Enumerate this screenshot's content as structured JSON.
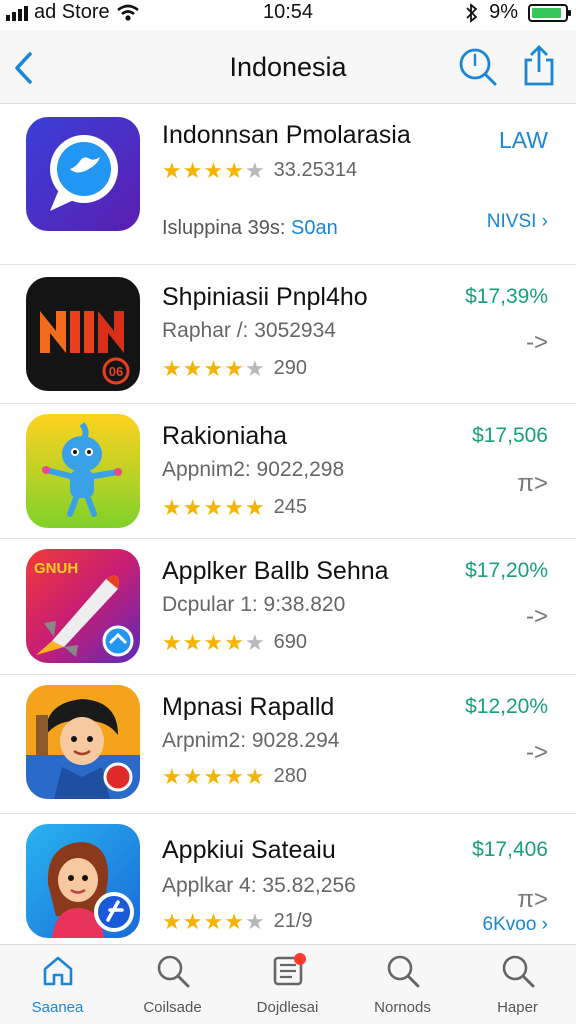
{
  "status_bar": {
    "carrier": "ad Store",
    "time": "10:54",
    "battery": "9%",
    "battery_level": 0.9
  },
  "nav": {
    "title": "Indonesia",
    "icons": [
      "back-chevron-icon",
      "search-icon",
      "share-icon"
    ]
  },
  "apps": [
    {
      "name": "Indonnsan Pmolarasia",
      "rating_text": "33.25314",
      "rating": 3.5,
      "detail_prefix": "Isluppina 39s:",
      "detail_highlight": "S0an",
      "action": "LAW",
      "more": "NIVSI ›"
    },
    {
      "name": "Shpiniasii Pnpl4ho",
      "subtitle": "Raphar /: 3052934",
      "rating": 4,
      "rating_count": "290",
      "price": "$17,39%",
      "arrow": "->"
    },
    {
      "name": "Rakioniaha",
      "subtitle": "Appnim2: 9022,298",
      "rating": 4.5,
      "rating_count": "245",
      "price": "$17,506",
      "arrow": "π>"
    },
    {
      "name": "Applker Ballb Sehna",
      "subtitle": "Dcpular 1: 9:38.820",
      "rating": 4,
      "rating_count": "690",
      "price": "$17,20%",
      "arrow": "->"
    },
    {
      "name": "Mpnasi Rapalld",
      "subtitle": "Arpnim2: 9028.294",
      "rating": 4.5,
      "rating_count": "280",
      "price": "$12,20%",
      "arrow": "->"
    },
    {
      "name": "Appkiui Sateaiu",
      "subtitle": "Applkar 4: 35.82,256",
      "rating": 4,
      "rating_count": "21/9",
      "price": "$17,406",
      "arrow": "π>",
      "more": "6Kvoo ›"
    }
  ],
  "tabs": [
    {
      "label": "Saanea",
      "icon": "home-icon",
      "active": true
    },
    {
      "label": "Coilsade",
      "icon": "search-icon"
    },
    {
      "label": "Dojdlesai",
      "icon": "updates-icon"
    },
    {
      "label": "Nornods",
      "icon": "search-icon"
    },
    {
      "label": "Haper",
      "icon": "search-icon"
    }
  ],
  "colors": {
    "accent": "#1a86d6",
    "price": "#19a07a",
    "star": "#f5b400",
    "badge": "#ff3b30"
  }
}
